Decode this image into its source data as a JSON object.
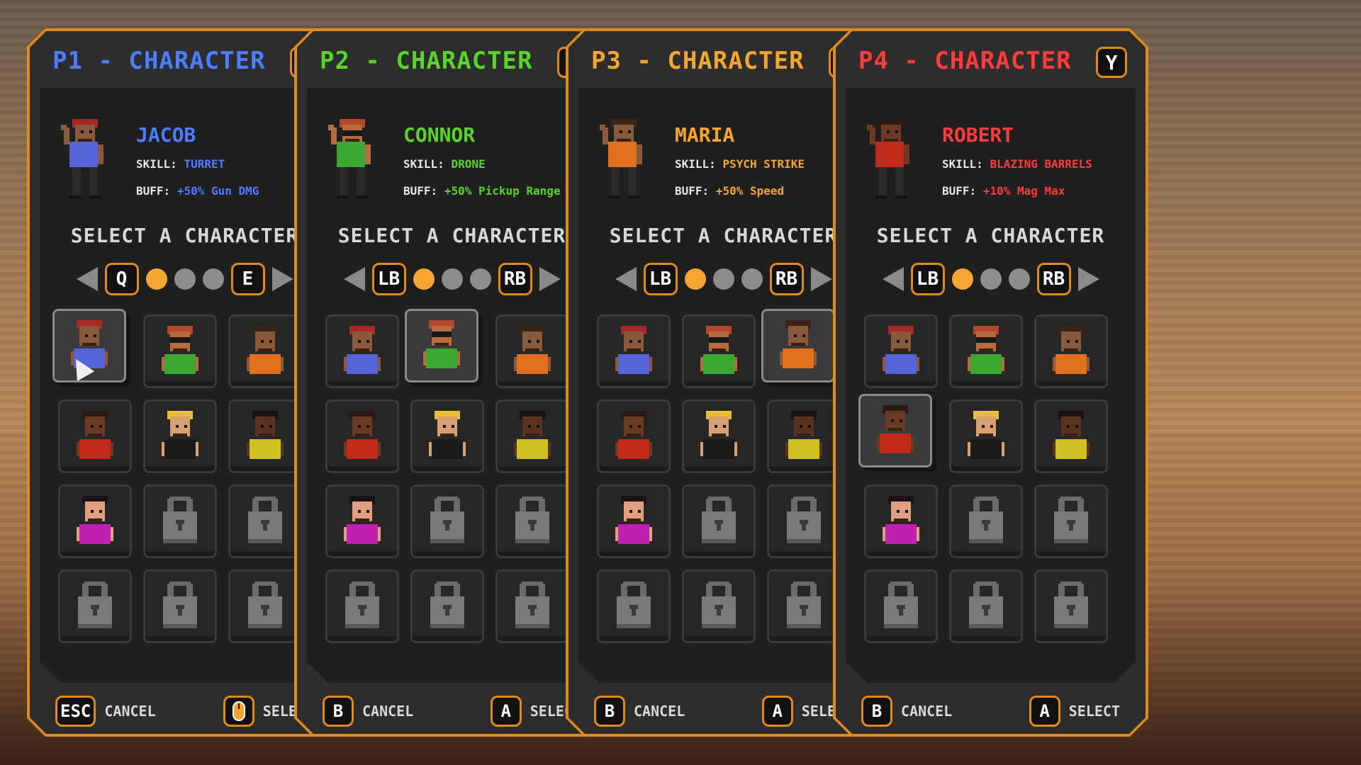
{
  "colors": {
    "accent": "#e08a1e",
    "p1": "#4d7dff",
    "p2": "#58d42a",
    "p3": "#f5a531",
    "p4": "#ff3b3b",
    "dot_active": "#f5a531",
    "dot_inactive": "#8c8c8c"
  },
  "panels": [
    {
      "title": "P1 - CHARACTER",
      "title_key": "mouse",
      "color": "#4d7dff",
      "name": "JACOB",
      "skill_label": "SKILL:",
      "skill": "TURRET",
      "buff_label": "BUFF:",
      "buff": "+50% Gun DMG",
      "select_text": "SELECT A CHARACTER",
      "prev_key": "Q",
      "next_key": "E",
      "selected_index": 0,
      "cancel_key": "ESC",
      "cancel_label": "CANCEL",
      "select_key": "mouse",
      "select_label": "SELECT"
    },
    {
      "title": "P2 - CHARACTER",
      "title_key": "Y",
      "color": "#58d42a",
      "name": "CONNOR",
      "skill_label": "SKILL:",
      "skill": "DRONE",
      "buff_label": "BUFF:",
      "buff": "+50% Pickup Range",
      "select_text": "SELECT A CHARACTER",
      "prev_key": "LB",
      "next_key": "RB",
      "selected_index": 1,
      "cancel_key": "B",
      "cancel_label": "CANCEL",
      "select_key": "A",
      "select_label": "SELECT"
    },
    {
      "title": "P3 - CHARACTER",
      "title_key": "Y",
      "color": "#f5a531",
      "name": "MARIA",
      "skill_label": "SKILL:",
      "skill": "PSYCH STRIKE",
      "buff_label": "BUFF:",
      "buff": "+50% Speed",
      "select_text": "SELECT A CHARACTER",
      "prev_key": "LB",
      "next_key": "RB",
      "selected_index": 2,
      "cancel_key": "B",
      "cancel_label": "CANCEL",
      "select_key": "A",
      "select_label": "SELECT"
    },
    {
      "title": "P4 - CHARACTER",
      "title_key": "Y",
      "color": "#ff3b3b",
      "name": "ROBERT",
      "skill_label": "SKILL:",
      "skill": "BLAZING BARRELS",
      "buff_label": "BUFF:",
      "buff": "+10% Mag Max",
      "select_text": "SELECT A CHARACTER",
      "prev_key": "LB",
      "next_key": "RB",
      "selected_index": 3,
      "cancel_key": "B",
      "cancel_label": "CANCEL",
      "select_key": "A",
      "select_label": "SELECT"
    }
  ],
  "roster": [
    {
      "id": "jacob",
      "skin": "#8a5a3c",
      "hair": "#a82828",
      "shirt": "#5563d8",
      "glasses": false,
      "locked": false
    },
    {
      "id": "connor",
      "skin": "#b86a40",
      "hair": "#b5482a",
      "shirt": "#3aa830",
      "glasses": true,
      "locked": false
    },
    {
      "id": "maria",
      "skin": "#8a5a3c",
      "hair": "#3a2418",
      "shirt": "#e0701e",
      "glasses": false,
      "locked": false
    },
    {
      "id": "robert",
      "skin": "#6a3a22",
      "hair": "#2a1a14",
      "shirt": "#c02a1a",
      "glasses": false,
      "locked": false
    },
    {
      "id": "blond",
      "skin": "#d9a074",
      "hair": "#e8c030",
      "shirt": "#1a1a1a",
      "glasses": false,
      "locked": false
    },
    {
      "id": "yellow",
      "skin": "#5a3420",
      "hair": "#1a1210",
      "shirt": "#d0c020",
      "glasses": false,
      "locked": false
    },
    {
      "id": "pink",
      "skin": "#e0a080",
      "hair": "#1a1218",
      "shirt": "#c020b0",
      "glasses": false,
      "locked": false
    },
    {
      "id": "lock1",
      "locked": true
    },
    {
      "id": "lock2",
      "locked": true
    },
    {
      "id": "lock3",
      "locked": true
    },
    {
      "id": "lock4",
      "locked": true
    },
    {
      "id": "lock5",
      "locked": true
    }
  ],
  "page_dots": 3,
  "active_dot": 0
}
